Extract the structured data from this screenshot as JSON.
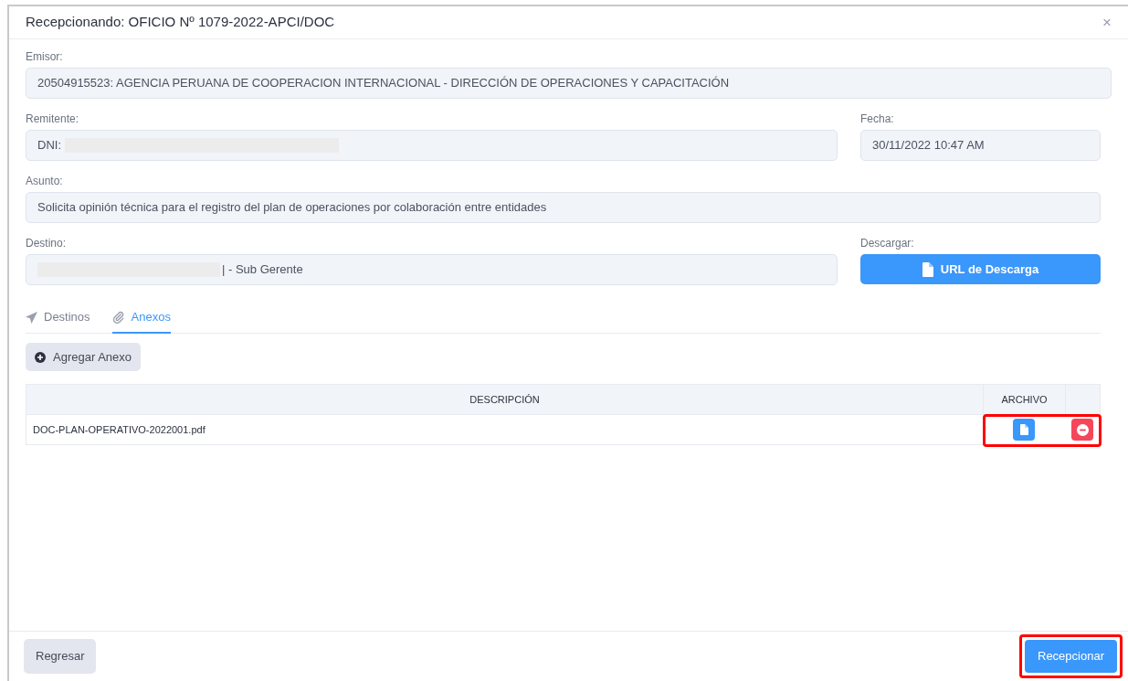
{
  "dialog": {
    "title": "Recepcionando: OFICIO Nº 1079-2022-APCI/DOC",
    "close": "×"
  },
  "fields": {
    "emisor": {
      "label": "Emisor:",
      "value": "20504915523: AGENCIA PERUANA DE COOPERACION INTERNACIONAL - DIRECCIÓN DE OPERACIONES Y CAPACITACIÓN"
    },
    "remitente": {
      "label": "Remitente:",
      "value": "DNI:"
    },
    "fecha": {
      "label": "Fecha:",
      "value": "30/11/2022 10:47 AM"
    },
    "asunto": {
      "label": "Asunto:",
      "value": "Solicita opinión técnica para el registro del plan de operaciones por colaboración entre entidades"
    },
    "destino": {
      "label": "Destino:",
      "value": "| - Sub Gerente"
    },
    "descargar": {
      "label": "Descargar:",
      "button": "URL de Descarga"
    }
  },
  "tabs": [
    {
      "label": "Destinos",
      "selected": false,
      "kind": "send"
    },
    {
      "label": "Anexos",
      "selected": true,
      "kind": "clip"
    }
  ],
  "add_button": "Agregar Anexo",
  "table": {
    "columns": [
      "DESCRIPCIÓN",
      "ARCHIVO"
    ],
    "rows": [
      {
        "descripcion": "DOC-PLAN-OPERATIVO-2022001.pdf"
      }
    ]
  },
  "footer": {
    "back": "Regresar",
    "submit": "Recepcionar"
  }
}
